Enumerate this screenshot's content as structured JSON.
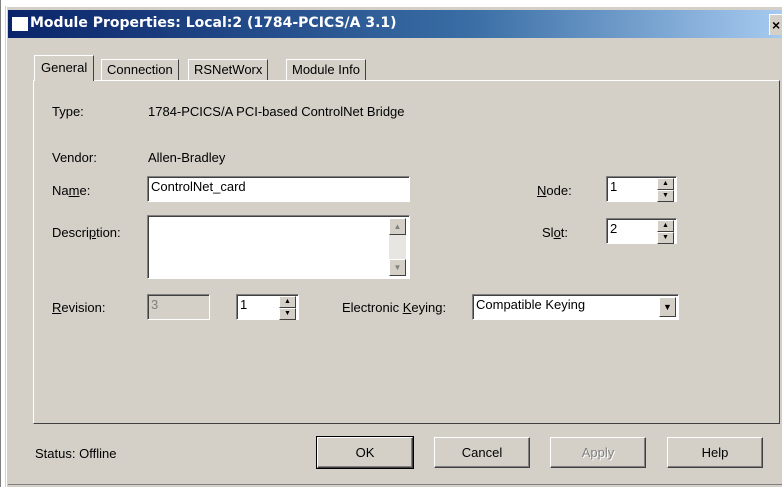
{
  "window": {
    "title": "Module Properties: Local:2 (1784-PCICS/A 3.1)",
    "close_glyph": "×"
  },
  "tabs": [
    {
      "label": "General",
      "active": true
    },
    {
      "label": "Connection",
      "active": false
    },
    {
      "label": "RSNetWorx",
      "active": false
    },
    {
      "label": "Module Info",
      "active": false
    }
  ],
  "general": {
    "type_label": "Type:",
    "type_value": "1784-PCICS/A PCI-based ControlNet Bridge",
    "vendor_label": "Vendor:",
    "vendor_value": "Allen-Bradley",
    "name_label_pre": "Na",
    "name_label_ul": "m",
    "name_label_post": "e:",
    "name_value": "ControlNet_card",
    "description_label_pre": "Descri",
    "description_label_ul": "p",
    "description_label_post": "tion:",
    "description_value": "",
    "node_label_ul": "N",
    "node_label_post": "ode:",
    "node_value": "1",
    "slot_label_pre": "Sl",
    "slot_label_ul": "o",
    "slot_label_post": "t:",
    "slot_value": "2",
    "revision_label_ul": "R",
    "revision_label_post": "evision:",
    "revision_major": "3",
    "revision_minor": "1",
    "keying_label_pre": "Electronic ",
    "keying_label_ul": "K",
    "keying_label_post": "eying:",
    "keying_value": "Compatible Keying"
  },
  "footer": {
    "status_label": "Status:",
    "status_value": "Offline",
    "ok_label": "OK",
    "cancel_label": "Cancel",
    "apply_label": "Apply",
    "help_label": "Help"
  },
  "colors": {
    "title_bar": "#0a246a",
    "dialog_face": "#d4d0c8"
  },
  "icons": {
    "spin_up": "▲",
    "spin_down": "▼",
    "dropdown": "▼",
    "scroll_up": "▲",
    "scroll_down": "▼"
  }
}
